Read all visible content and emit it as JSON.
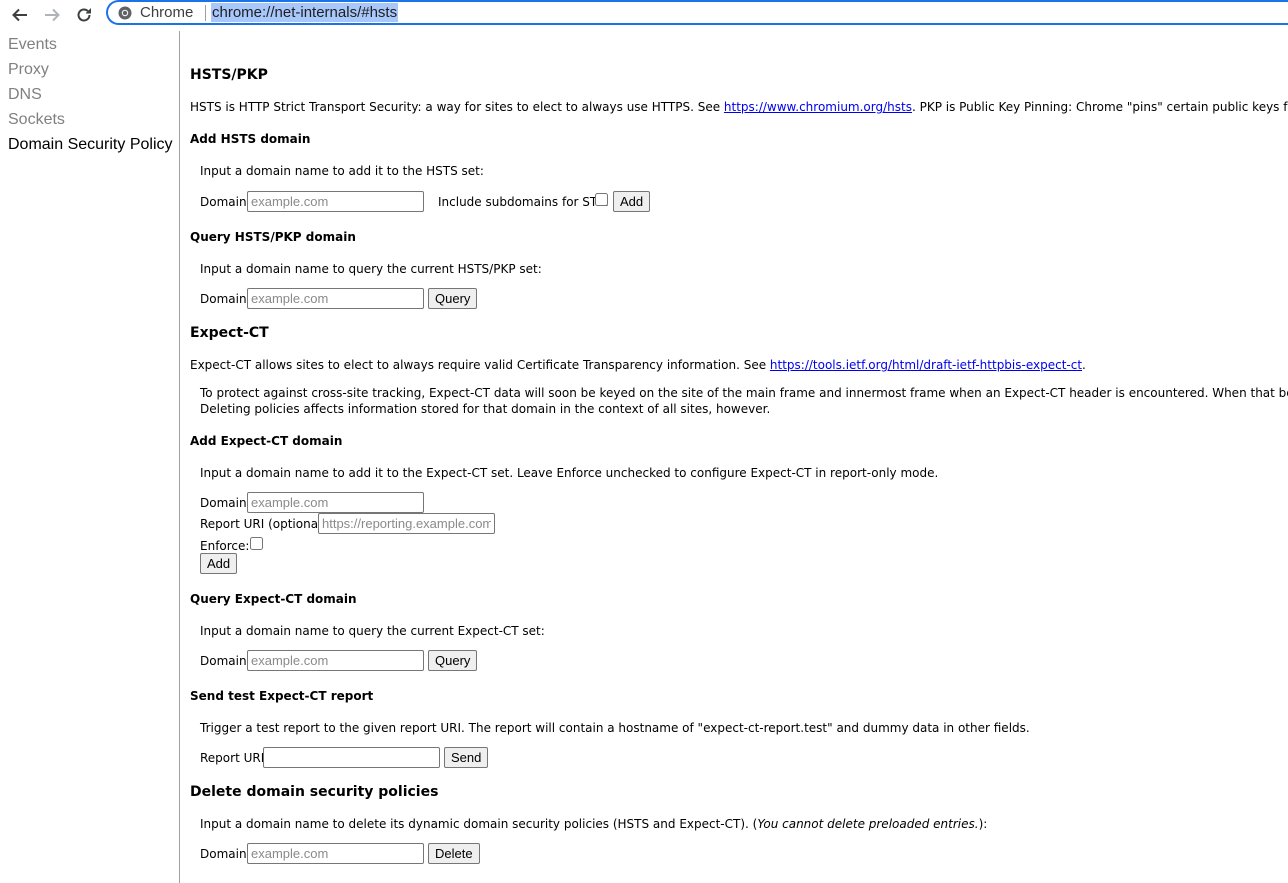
{
  "browser": {
    "chrome_label": "Chrome",
    "url": "chrome://net-internals/#hsts"
  },
  "sidebar": {
    "items": [
      {
        "label": "Events"
      },
      {
        "label": "Proxy"
      },
      {
        "label": "DNS"
      },
      {
        "label": "Sockets"
      },
      {
        "label": "Domain Security Policy"
      }
    ]
  },
  "hsts": {
    "title": "HSTS/PKP",
    "desc_pre": "HSTS is HTTP Strict Transport Security: a way for sites to elect to always use HTTPS. See ",
    "desc_link": "https://www.chromium.org/hsts",
    "desc_post": ". PKP is Public Key Pinning: Chrome \"pins\" certain public keys for certain sites in official b",
    "add": {
      "title": "Add HSTS domain",
      "instructions": "Input a domain name to add it to the HSTS set:",
      "domain_label": "Domain:",
      "domain_placeholder": "example.com",
      "subdomains_label": "Include subdomains for STS:",
      "add_button": "Add"
    },
    "query": {
      "title": "Query HSTS/PKP domain",
      "instructions": "Input a domain name to query the current HSTS/PKP set:",
      "domain_label": "Domain:",
      "domain_placeholder": "example.com",
      "query_button": "Query"
    }
  },
  "expect_ct": {
    "title": "Expect-CT",
    "desc_pre": "Expect-CT allows sites to elect to always require valid Certificate Transparency information. See ",
    "desc_link": "https://tools.ietf.org/html/draft-ietf-httpbis-expect-ct",
    "desc_post": ".",
    "note_line1": "To protect against cross-site tracking, Expect-CT data will soon be keyed on the site of the main frame and innermost frame when an Expect-CT header is encountered. When that behavior is enabled, both ac",
    "note_line2": "Deleting policies affects information stored for that domain in the context of all sites, however.",
    "add": {
      "title": "Add Expect-CT domain",
      "instructions": "Input a domain name to add it to the Expect-CT set. Leave Enforce unchecked to configure Expect-CT in report-only mode.",
      "domain_label": "Domain:",
      "domain_placeholder": "example.com",
      "report_uri_label": "Report URI (optional):",
      "report_uri_placeholder": "https://reporting.example.com",
      "enforce_label": "Enforce:",
      "add_button": "Add"
    },
    "query": {
      "title": "Query Expect-CT domain",
      "instructions": "Input a domain name to query the current Expect-CT set:",
      "domain_label": "Domain:",
      "domain_placeholder": "example.com",
      "query_button": "Query"
    },
    "test_report": {
      "title": "Send test Expect-CT report",
      "instructions": "Trigger a test report to the given report URI. The report will contain a hostname of \"expect-ct-report.test\" and dummy data in other fields.",
      "report_uri_label": "Report URI:",
      "report_uri_value": "",
      "send_button": "Send"
    }
  },
  "delete_policies": {
    "title": "Delete domain security policies",
    "instructions_pre": "Input a domain name to delete its dynamic domain security policies (HSTS and Expect-CT). (",
    "instructions_italic": "You cannot delete preloaded entries.",
    "instructions_post": "):",
    "domain_label": "Domain:",
    "domain_placeholder": "example.com",
    "delete_button": "Delete"
  }
}
